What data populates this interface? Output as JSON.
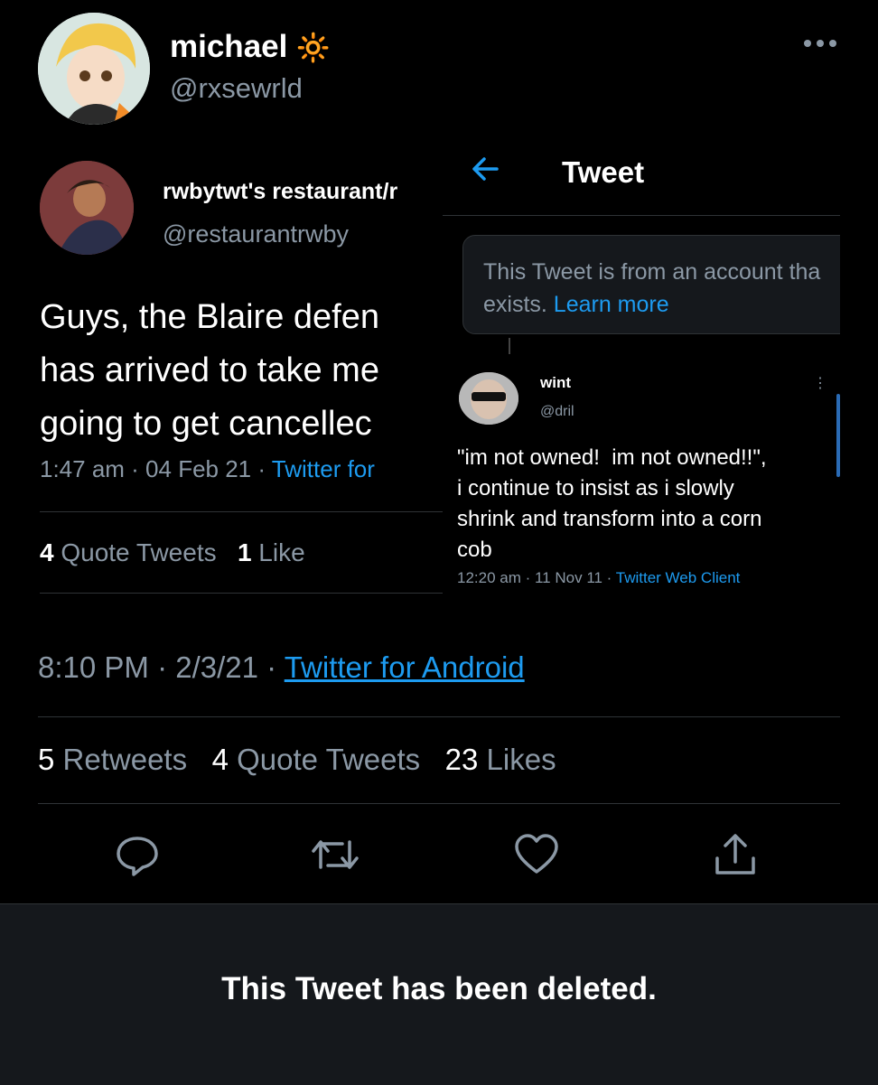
{
  "author": {
    "name": "michael",
    "emoji": "🔆",
    "handle": "@rxsewrld"
  },
  "quoted_left": {
    "name": "rwbytwt's restaurant/r",
    "handle": "@restaurantrwby",
    "text": "Guys, the Blaire defen\nhas arrived to take me\ngoing to get cancellec",
    "meta_time": "1:47 am · 04 Feb 21 · ",
    "meta_source": "Twitter for",
    "stats": {
      "quote_count": "4",
      "quote_label": " Quote Tweets",
      "like_count": "1",
      "like_label": " Like"
    }
  },
  "quoted_right": {
    "back_icon": "arrow-left-icon",
    "title": "Tweet",
    "notice_text": "This Tweet is from an account tha\nexists. ",
    "notice_link": "Learn more",
    "name": "wint",
    "handle": "@dril",
    "text": "\"im not owned!  im not owned!!\",\ni continue to insist as i slowly\nshrink and transform into a corn\ncob",
    "meta_time": "12:20 am · 11 Nov 11 · ",
    "meta_source": "Twitter Web Client"
  },
  "tweet": {
    "time": "8:10 PM · 2/3/21 · ",
    "source": "Twitter for Android",
    "stats": {
      "retweets_count": "5",
      "retweets_label": " Retweets",
      "quotes_count": "4",
      "quotes_label": " Quote Tweets",
      "likes_count": "23",
      "likes_label": " Likes"
    }
  },
  "actions": [
    "reply-icon",
    "retweet-icon",
    "like-icon",
    "share-icon"
  ],
  "deleted_notice": "This Tweet has been deleted.",
  "colors": {
    "accent": "#1d9bf0",
    "muted": "#8b98a5",
    "background": "#000000"
  }
}
